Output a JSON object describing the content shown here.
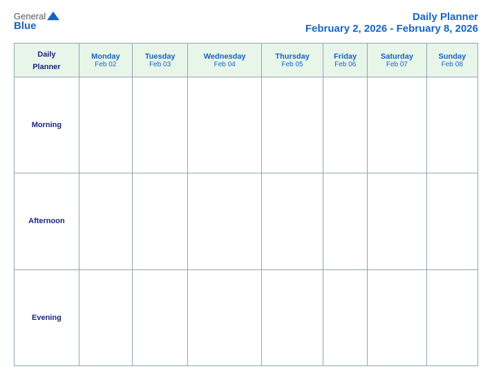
{
  "header": {
    "logo_general": "General",
    "logo_blue": "Blue",
    "title_line1": "Daily Planner",
    "title_line2": "February 2, 2026 - February 8, 2026"
  },
  "table": {
    "col0": {
      "line1": "Daily",
      "line2": "Planner",
      "date": ""
    },
    "columns": [
      {
        "day": "Monday",
        "date": "Feb 02"
      },
      {
        "day": "Tuesday",
        "date": "Feb 03"
      },
      {
        "day": "Wednesday",
        "date": "Feb 04"
      },
      {
        "day": "Thursday",
        "date": "Feb 05"
      },
      {
        "day": "Friday",
        "date": "Feb 06"
      },
      {
        "day": "Saturday",
        "date": "Feb 07"
      },
      {
        "day": "Sunday",
        "date": "Feb 08"
      }
    ],
    "rows": [
      {
        "label": "Morning"
      },
      {
        "label": "Afternoon"
      },
      {
        "label": "Evening"
      }
    ]
  }
}
